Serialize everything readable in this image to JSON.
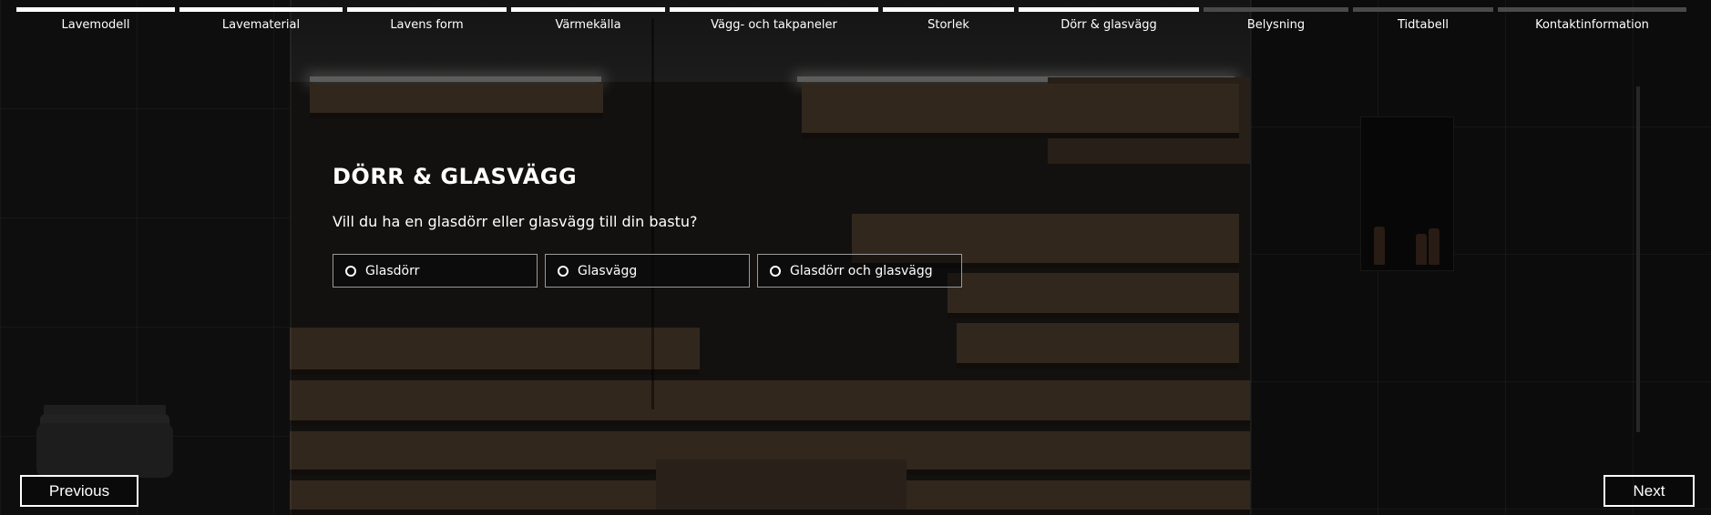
{
  "progress": {
    "steps": [
      {
        "label": "Lavemodell",
        "done": true
      },
      {
        "label": "Lavematerial",
        "done": true
      },
      {
        "label": "Lavens form",
        "done": true
      },
      {
        "label": "Värmekälla",
        "done": true
      },
      {
        "label": "Vägg- och takpaneler",
        "done": true
      },
      {
        "label": "Storlek",
        "done": true
      },
      {
        "label": "Dörr & glasvägg",
        "done": true
      },
      {
        "label": "Belysning",
        "done": false
      },
      {
        "label": "Tidtabell",
        "done": false
      },
      {
        "label": "Kontaktinformation",
        "done": false
      }
    ]
  },
  "panel": {
    "title": "DÖRR & GLASVÄGG",
    "question": "Vill du ha en glasdörr eller glasvägg till din bastu?",
    "options": [
      {
        "label": "Glasdörr",
        "selected": false
      },
      {
        "label": "Glasvägg",
        "selected": false
      },
      {
        "label": "Glasdörr och glasvägg",
        "selected": false
      }
    ]
  },
  "footer": {
    "previous_label": "Previous",
    "next_label": "Next"
  },
  "colors": {
    "active_step": "#ffffff",
    "inactive_step": "#4a4a4a",
    "text": "#ffffff"
  }
}
